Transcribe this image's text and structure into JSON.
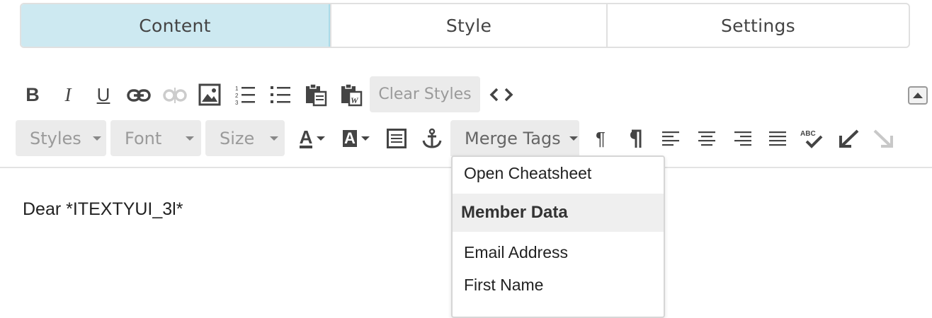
{
  "tabs": [
    {
      "label": "Content",
      "active": true
    },
    {
      "label": "Style",
      "active": false
    },
    {
      "label": "Settings",
      "active": false
    }
  ],
  "toolbar_row1": {
    "bold_label": "B",
    "italic_label": "I",
    "underline_label": "U",
    "clear_styles_label": "Clear Styles",
    "source_label": "<>"
  },
  "toolbar_row2": {
    "styles_label": "Styles",
    "font_label": "Font",
    "size_label": "Size",
    "merge_tags_label": "Merge Tags",
    "text_color_label": "A",
    "bg_color_label": "A"
  },
  "editor": {
    "body_text": "Dear *ITEXTYUI_3l*"
  },
  "merge_tags_menu": {
    "open_cheatsheet": "Open Cheatsheet",
    "section_header": "Member Data",
    "items": [
      "Email Address",
      "First Name"
    ]
  },
  "colors": {
    "active_tab_bg": "#cde9f1",
    "button_bg": "#ebebeb"
  }
}
